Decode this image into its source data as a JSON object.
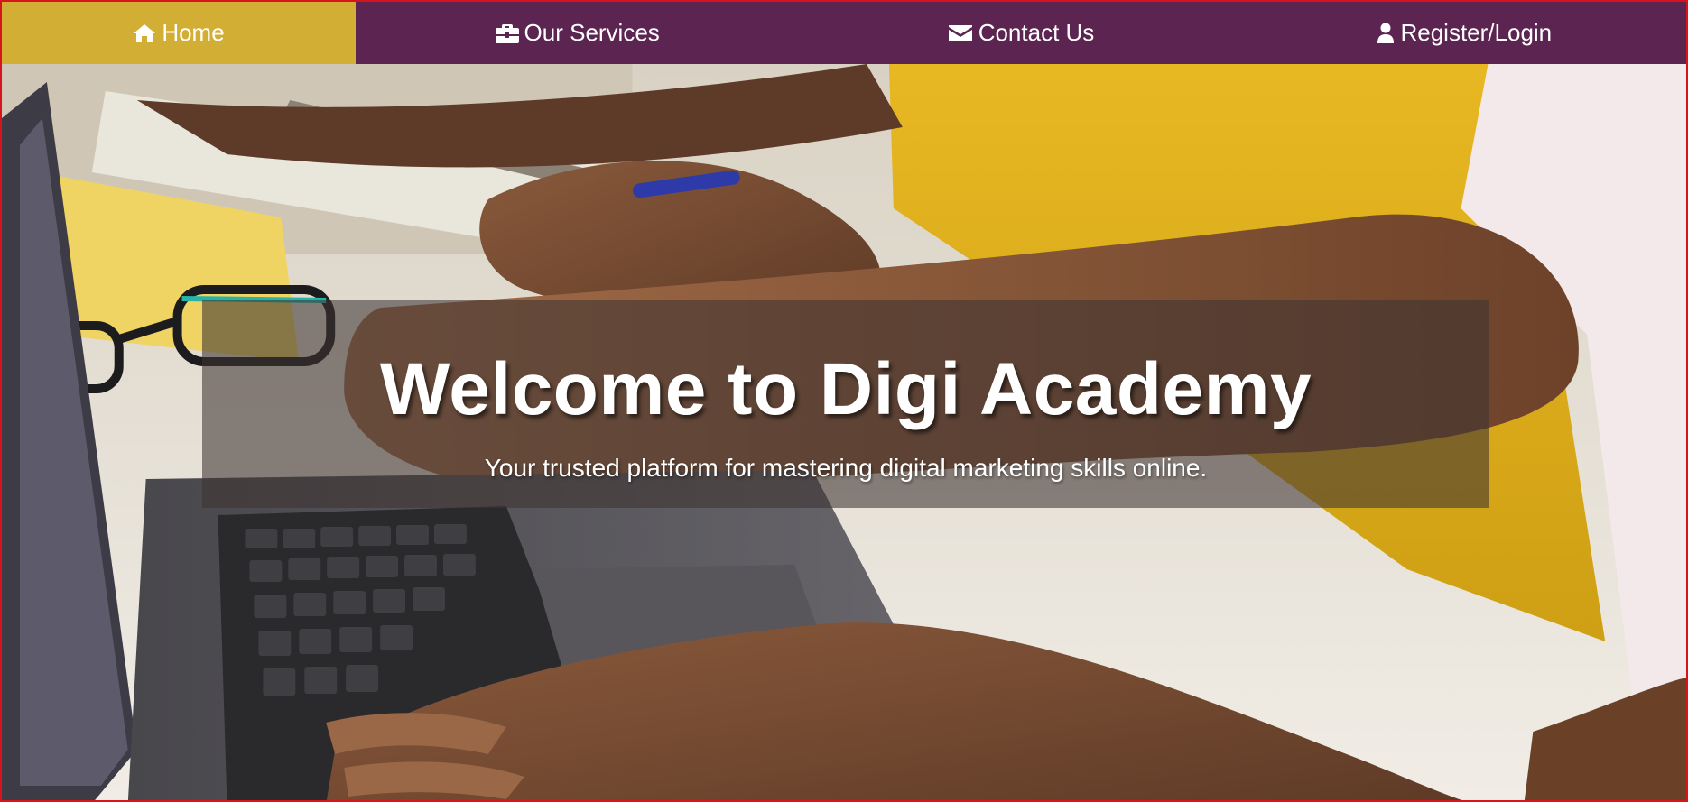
{
  "nav": {
    "items": [
      {
        "label": "Home",
        "icon": "home-icon",
        "active": true
      },
      {
        "label": "Our Services",
        "icon": "briefcase-icon",
        "active": false
      },
      {
        "label": "Contact Us",
        "icon": "envelope-icon",
        "active": false
      },
      {
        "label": "Register/Login",
        "icon": "user-icon",
        "active": false
      }
    ]
  },
  "hero": {
    "title": "Welcome to Digi Academy",
    "subtitle": "Your trusted platform for mastering digital marketing skills online."
  },
  "colors": {
    "nav_background": "#5b2451",
    "nav_active": "#d3ae35",
    "frame_border": "#d7141b",
    "text": "#ffffff"
  }
}
